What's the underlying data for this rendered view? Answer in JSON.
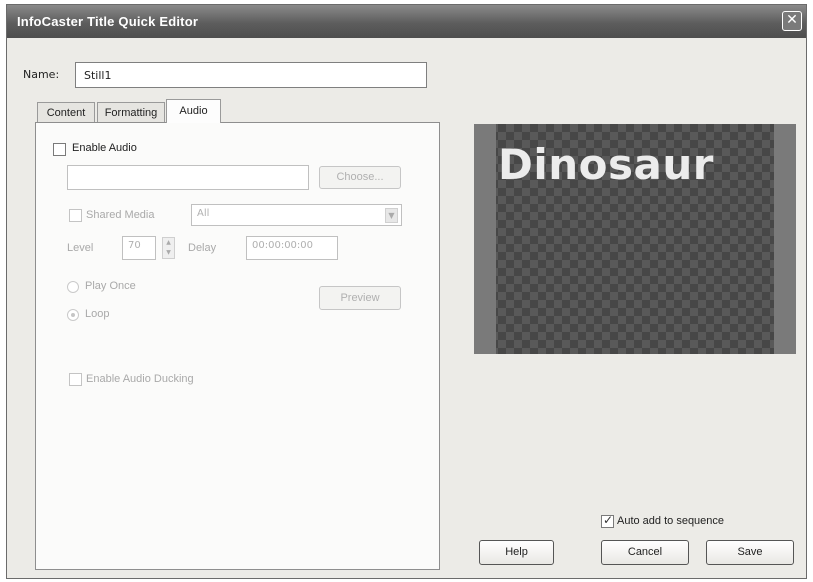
{
  "window": {
    "title": "InfoCaster Title Quick Editor",
    "close_glyph": "✕"
  },
  "name": {
    "label": "Name:",
    "value": "Still1"
  },
  "tabs": [
    {
      "label": "Content",
      "active": false
    },
    {
      "label": "Formatting",
      "active": false
    },
    {
      "label": "Audio",
      "active": true
    }
  ],
  "audio": {
    "enable_label": "Enable Audio",
    "enable_checked": false,
    "file_value": "",
    "choose_label": "Choose...",
    "shared_media_label": "Shared Media",
    "shared_media_value": "All",
    "level_label": "Level",
    "level_value": "70",
    "delay_label": "Delay",
    "delay_value": "00:00:00:00",
    "play_once_label": "Play Once",
    "loop_label": "Loop",
    "loop_selected": true,
    "preview_label": "Preview",
    "ducking_label": "Enable Audio Ducking"
  },
  "preview_pane": {
    "text": "Dinosaur"
  },
  "footer": {
    "auto_add_label": "Auto add to sequence",
    "auto_add_checked": true,
    "help_label": "Help",
    "cancel_label": "Cancel",
    "save_label": "Save"
  }
}
